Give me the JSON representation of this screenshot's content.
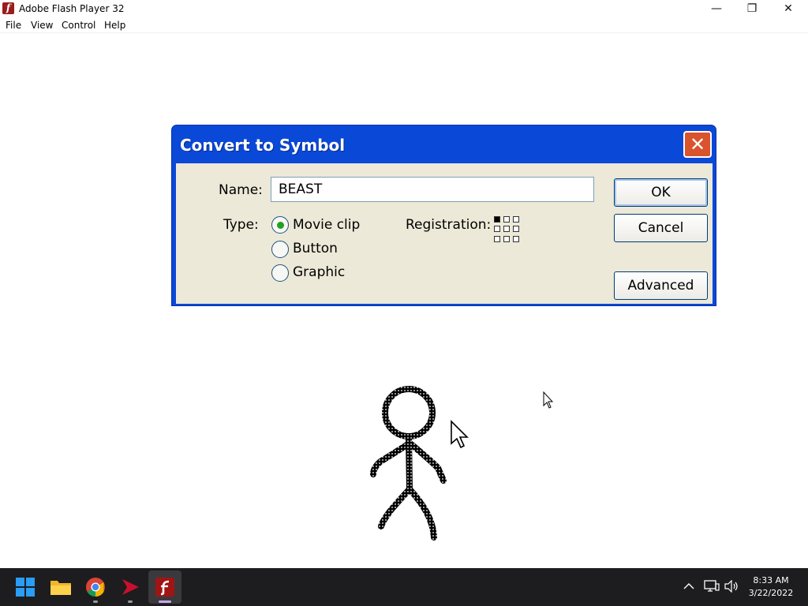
{
  "window": {
    "title": "Adobe Flash Player 32",
    "app_icon_glyph": "f",
    "minimize_glyph": "—",
    "maximize_glyph": "❐",
    "close_glyph": "✕"
  },
  "menu": {
    "items": [
      "File",
      "View",
      "Control",
      "Help"
    ]
  },
  "dialog": {
    "title": "Convert to Symbol",
    "close_glyph": "✕",
    "name_label": "Name:",
    "name_value": "BEAST",
    "type_label": "Type:",
    "types": [
      {
        "label": "Movie clip",
        "checked": true
      },
      {
        "label": "Button",
        "checked": false
      },
      {
        "label": "Graphic",
        "checked": false
      }
    ],
    "registration_label": "Registration:",
    "registration_selected": "top-left",
    "buttons": {
      "ok": "OK",
      "cancel": "Cancel",
      "advanced": "Advanced"
    }
  },
  "taskbar": {
    "icons": [
      "windows-start-icon",
      "file-explorer-icon",
      "chrome-icon",
      "adobe-animate-icon",
      "flash-player-icon"
    ],
    "time": "8:33 AM",
    "date": "3/22/2022"
  },
  "colors": {
    "dialog_titlebar": "#0a48d8",
    "dialog_body": "#ece9d8",
    "close_button": "#d9532c",
    "taskbar": "#1d1d1f",
    "radio_checked": "#21a121"
  }
}
